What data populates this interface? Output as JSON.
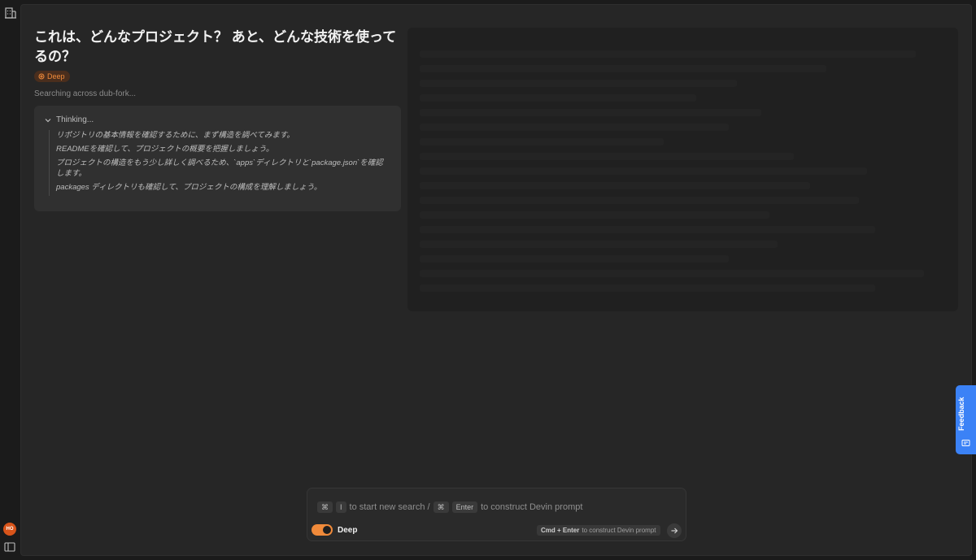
{
  "sidebar": {
    "logo_icon": "building-icon",
    "avatar_initials": "HO",
    "toggle_icon": "sidebar-toggle-icon"
  },
  "question": {
    "text": "これは、どんなプロジェクト？ あと、どんな技術を使ってるの？"
  },
  "mode_badge": {
    "label": "Deep",
    "icon": "deep-icon"
  },
  "status": {
    "text": "Searching across dub-fork..."
  },
  "thinking": {
    "header": "Thinking...",
    "lines": [
      "リポジトリの基本情報を確認するために、まず構造を調べてみます。",
      "READMEを確認して、プロジェクトの概要を把握しましょう。",
      "プロジェクトの構造をもう少し詳しく調べるため、`apps`ディレクトリと`package.json`を確認します。",
      "packages ディレクトリも確認して、プロジェクトの構成を理解しましょう。"
    ]
  },
  "feedback": {
    "label": "Feedback"
  },
  "prompt": {
    "key_cmd": "⌘",
    "key_i": "I",
    "hint_new_search": "to start new search /",
    "key_cmd2": "⌘",
    "key_enter": "Enter",
    "hint_construct": "to construct Devin prompt",
    "toggle_label": "Deep",
    "toggle_on": true,
    "cmd_enter_keys": "Cmd + Enter",
    "cmd_enter_text": "to construct Devin prompt"
  },
  "colors": {
    "accent": "#f08a3a",
    "feedback": "#3b82f6",
    "avatar": "#d8541a"
  }
}
